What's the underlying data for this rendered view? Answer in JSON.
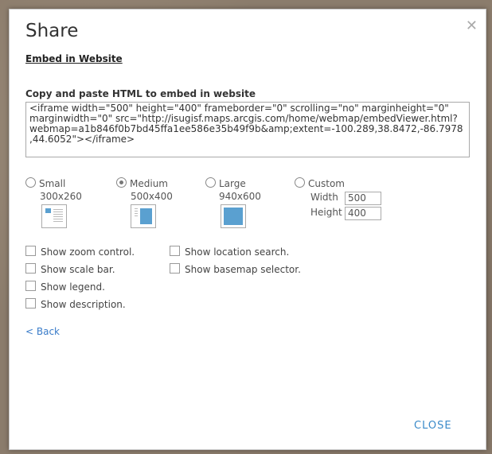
{
  "dialog": {
    "title": "Share",
    "close_icon": "close-icon",
    "subtitle": "Embed in Website",
    "section_label": "Copy and paste HTML to embed in website",
    "embed_code": "<iframe width=\"500\" height=\"400\" frameborder=\"0\" scrolling=\"no\" marginheight=\"0\" marginwidth=\"0\" src=\"http://isugisf.maps.arcgis.com/home/webmap/embedViewer.html?webmap=a1b846f0b7bd45ffa1ee586e35b49f9b&amp;extent=-100.289,38.8472,-86.7978,44.6052\"></iframe>"
  },
  "sizes": [
    {
      "label": "Small",
      "dims": "300x260",
      "selected": false
    },
    {
      "label": "Medium",
      "dims": "500x400",
      "selected": true
    },
    {
      "label": "Large",
      "dims": "940x600",
      "selected": false
    },
    {
      "label": "Custom",
      "selected": false
    }
  ],
  "custom": {
    "width_label": "Width",
    "width_value": "500",
    "height_label": "Height",
    "height_value": "400"
  },
  "options": {
    "zoom": "Show zoom control.",
    "scale": "Show scale bar.",
    "legend": "Show legend.",
    "description": "Show description.",
    "location_search": "Show location search.",
    "basemap": "Show basemap selector."
  },
  "back_label": "< Back",
  "close_label": "CLOSE",
  "colors": {
    "accent": "#3a8ac9",
    "thumb_fill": "#5aa0d0"
  }
}
